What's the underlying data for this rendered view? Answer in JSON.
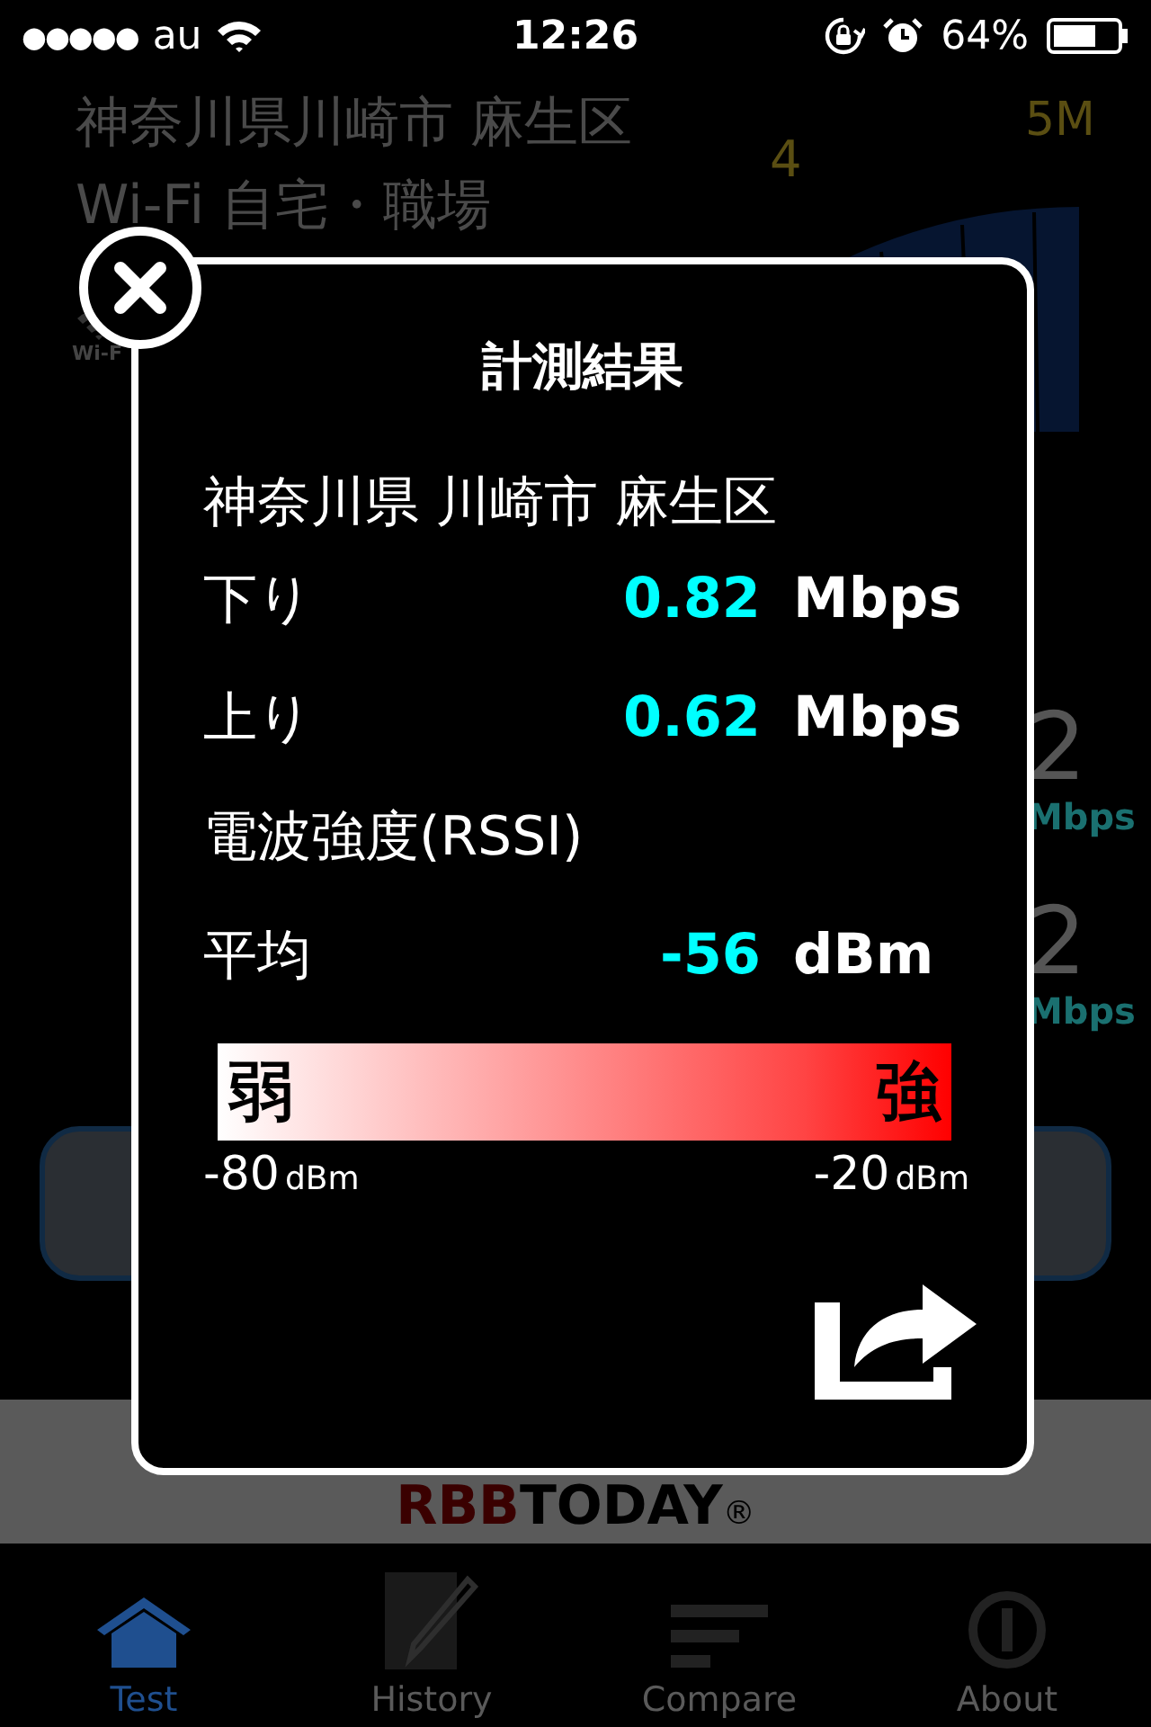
{
  "status_bar": {
    "signal": "●●●●●",
    "carrier": "au",
    "time": "12:26",
    "battery": "64%"
  },
  "background": {
    "location": "神奈川県川崎市 麻生区",
    "network": "Wi-Fi 自宅・職場",
    "network_icon_label": "Wi-F",
    "gauge_labels": [
      "4",
      "5M"
    ],
    "readings": [
      {
        "value": "2",
        "unit": "Mbps"
      },
      {
        "value": "2",
        "unit": "Mbps"
      }
    ],
    "banner": {
      "logo_strong": "RBB",
      "logo_rest": "TODAY",
      "mark": "®"
    }
  },
  "dialog": {
    "title": "計測結果",
    "location": "神奈川県 川崎市 麻生区",
    "rows": [
      {
        "kind": "value",
        "label": "下り",
        "value": "0.82",
        "unit": "Mbps"
      },
      {
        "kind": "value",
        "label": "上り",
        "value": "0.62",
        "unit": "Mbps"
      },
      {
        "kind": "heading",
        "label": "電波強度(RSSI)"
      },
      {
        "kind": "value",
        "label": "平均",
        "value": "-56",
        "unit": "dBm"
      }
    ],
    "scale": {
      "weak": "弱",
      "strong": "強",
      "min": "-80",
      "min_unit": "dBm",
      "max": "-20",
      "max_unit": "dBm"
    }
  },
  "tabs": [
    {
      "label": "Test",
      "selected": true
    },
    {
      "label": "History",
      "selected": false
    },
    {
      "label": "Compare",
      "selected": false
    },
    {
      "label": "About",
      "selected": false
    }
  ]
}
